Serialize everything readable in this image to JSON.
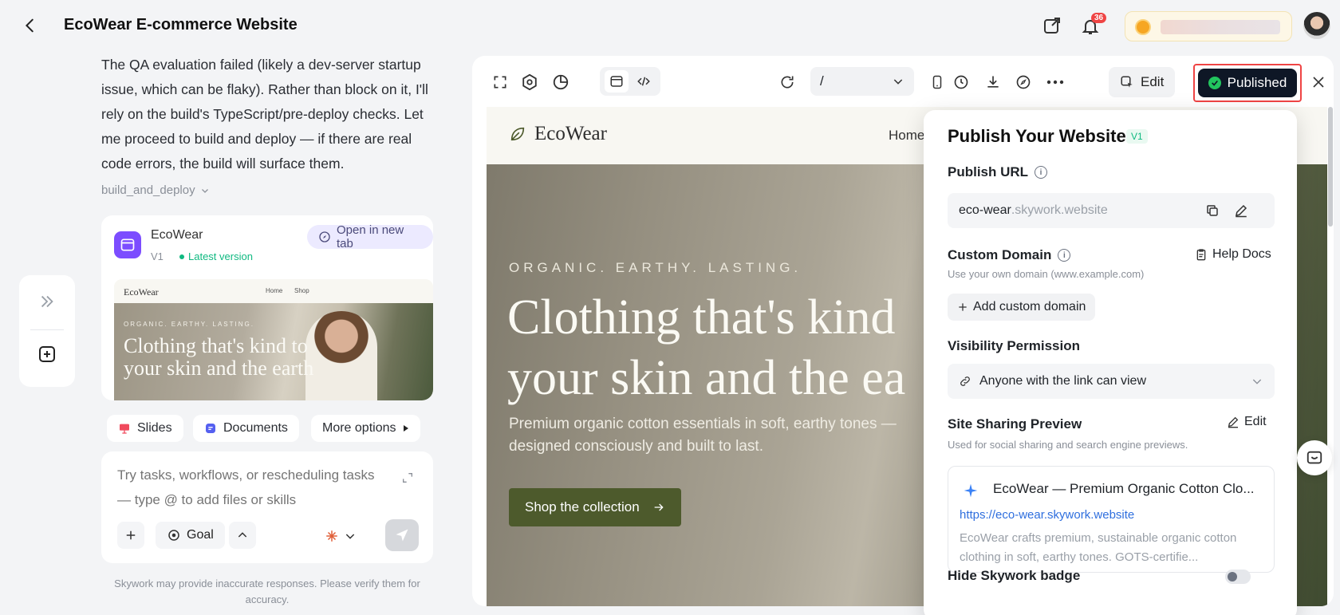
{
  "header": {
    "title": "EcoWear E-commerce Website",
    "notifications_count": "36"
  },
  "chat": {
    "message": "The QA evaluation failed (likely a dev-server startup issue, which can be flaky). Rather than block on it, I'll rely on the build's TypeScript/pre-deploy checks. Let me proceed to build and deploy — if there are real code errors, the build will surface them.",
    "tool_call": "build_and_deploy",
    "project_card": {
      "name": "EcoWear",
      "version": "V1",
      "latest_label": "Latest version",
      "open_label": "Open in new tab",
      "thumbnail": {
        "logo": "EcoWear",
        "nav_home": "Home",
        "nav_shop": "Shop",
        "kicker": "ORGANIC. EARTHY. LASTING.",
        "headline": "Clothing that's kind to your skin and the earth"
      }
    },
    "chips": {
      "slides": "Slides",
      "documents": "Documents",
      "more": "More options"
    },
    "composer": {
      "placeholder": "Try tasks, workflows, or rescheduling tasks — type @ to add files or skills",
      "goal_label": "Goal"
    },
    "disclaimer": "Skywork may provide inaccurate responses. Please verify them for accuracy."
  },
  "toolbar": {
    "route": "/",
    "edit_label": "Edit",
    "published_label": "Published"
  },
  "site": {
    "logo": "EcoWear",
    "nav_home": "Home",
    "kicker": "ORGANIC. EARTHY. LASTING.",
    "headline_line1": "Clothing that's kind",
    "headline_line2": "your skin and the ea",
    "subtext": "Premium organic cotton essentials in soft, earthy tones — designed consciously and built to last.",
    "cta": "Shop the collection"
  },
  "publish": {
    "title": "Publish Your Website",
    "version": "V1",
    "url_label": "Publish URL",
    "url_subdomain": "eco-wear",
    "url_domain": ".skywork.website",
    "custom_domain_label": "Custom Domain",
    "help_docs": "Help Docs",
    "custom_domain_hint": "Use your own domain (www.example.com)",
    "add_domain": "Add custom domain",
    "visibility_label": "Visibility Permission",
    "visibility_value": "Anyone with the link can view",
    "sharing_label": "Site Sharing Preview",
    "sharing_edit": "Edit",
    "sharing_hint": "Used for social sharing and search engine previews.",
    "card_title": "EcoWear — Premium Organic Cotton Clo...",
    "card_link": "https://eco-wear.skywork.website",
    "card_desc": "EcoWear crafts premium, sustainable organic cotton clothing in soft, earthy tones. GOTS-certifie...",
    "badge_label": "Hide Skywork badge"
  },
  "colors": {
    "accent_green": "#4d5a2c",
    "published_bg": "#0e1726",
    "highlight_red": "#ef4444",
    "brand_purple": "#7c4dff"
  }
}
